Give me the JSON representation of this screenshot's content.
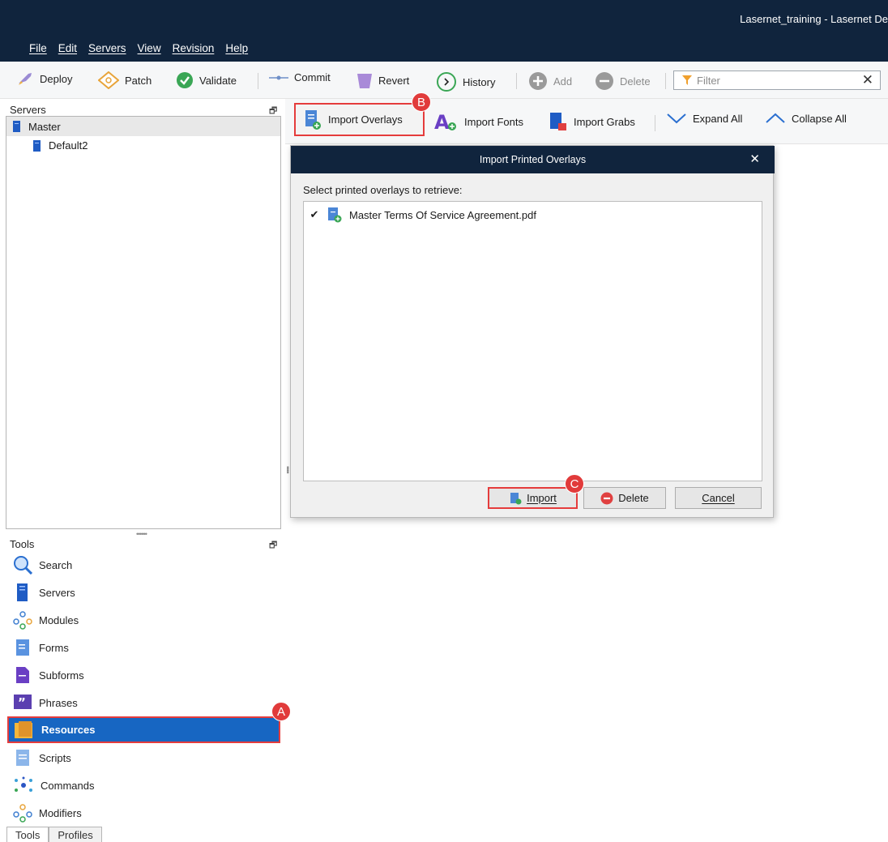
{
  "window": {
    "title": "Lasernet_training - Lasernet De"
  },
  "menu": [
    "File",
    "Edit",
    "Servers",
    "View",
    "Revision",
    "Help"
  ],
  "toolbar": {
    "deploy": "Deploy",
    "patch": "Patch",
    "validate": "Validate",
    "commit": "Commit",
    "revert": "Revert",
    "history": "History",
    "add": "Add",
    "delete": "Delete",
    "filter_placeholder": "Filter",
    "filter_clear": "✕"
  },
  "servers_panel": {
    "title": "Servers",
    "items": [
      "Master",
      "Default2"
    ]
  },
  "tools_panel": {
    "title": "Tools",
    "items": [
      "Search",
      "Servers",
      "Modules",
      "Forms",
      "Subforms",
      "Phrases",
      "Resources",
      "Scripts",
      "Commands",
      "Modifiers"
    ],
    "selected": "Resources"
  },
  "bottom_tabs": [
    "Tools",
    "Profiles"
  ],
  "resources_toolbar": {
    "import_overlays": "Import Overlays",
    "import_fonts": "Import Fonts",
    "import_grabs": "Import Grabs",
    "expand_all": "Expand All",
    "collapse_all": "Collapse All"
  },
  "dialog": {
    "title": "Import Printed Overlays",
    "label": "Select printed overlays to retrieve:",
    "files": [
      {
        "name": "Master Terms Of Service Agreement.pdf",
        "checked": true
      }
    ],
    "import": "Import",
    "delete": "Delete",
    "cancel": "Cancel"
  },
  "annotations": {
    "a": "A",
    "b": "B",
    "c": "C"
  },
  "colors": {
    "title_bar": "#10243d",
    "selection": "#1766c2",
    "highlight": "#e53c3c"
  }
}
